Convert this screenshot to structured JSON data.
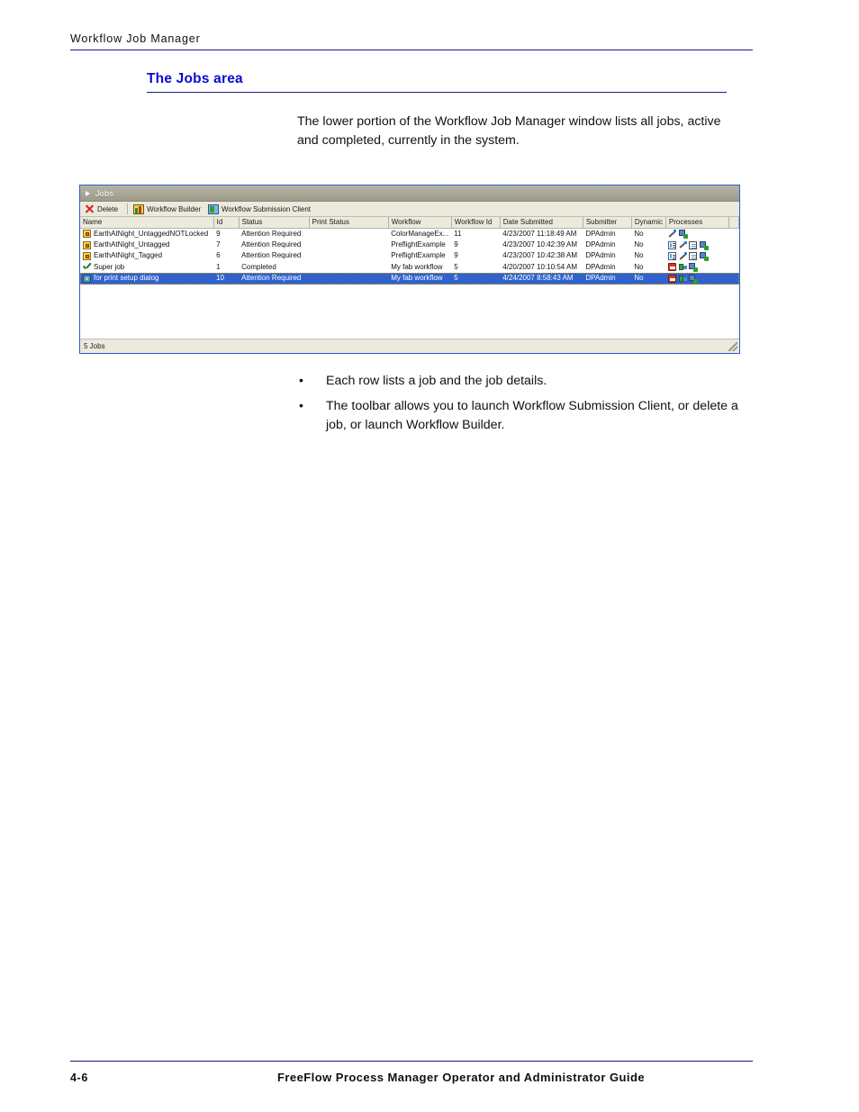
{
  "running_head": {
    "text": "Workflow Job Manager"
  },
  "section": {
    "heading": "The Jobs area"
  },
  "intro": {
    "paragraph": "The lower portion of the Workflow Job Manager window lists all jobs, active and completed, currently in the system."
  },
  "app": {
    "panel_title": "Jobs",
    "expander_icon": "triangle-right-icon",
    "toolbar": {
      "delete_label": "Delete",
      "delete_icon": "red-x-delete-icon",
      "workflow_builder_label": "Workflow Builder",
      "workflow_builder_icon": "workflow-builder-icon",
      "workflow_submission_client_label": "Workflow Submission Client",
      "workflow_submission_client_icon": "workflow-submission-client-icon"
    },
    "columns": [
      "Name",
      "Id",
      "Status",
      "Print Status",
      "Workflow",
      "Workflow Id",
      "Date Submitted",
      "Submitter",
      "Dynamic",
      "Processes"
    ],
    "rows": [
      {
        "icon": "folder-job-icon",
        "name": "EarthAtNight_UntaggedNOTLocked",
        "id": "9",
        "status": "Attention Required",
        "print_status": "",
        "workflow": "ColorManageEx...",
        "workflow_id": "11",
        "date_submitted": "4/23/2007 11:18:49 AM",
        "submitter": "DPAdmin",
        "dynamic": "No",
        "processes": [
          "wand-icon",
          "output-icon"
        ],
        "selected": false
      },
      {
        "icon": "folder-job-icon",
        "name": "EarthAtNight_Untagged",
        "id": "7",
        "status": "Attention Required",
        "print_status": "",
        "workflow": "PreflightExample",
        "workflow_id": "9",
        "date_submitted": "4/23/2007 10:42:39 AM",
        "submitter": "DPAdmin",
        "dynamic": "No",
        "processes": [
          "list-icon",
          "wand-icon",
          "document-icon",
          "output-icon"
        ],
        "selected": false
      },
      {
        "icon": "folder-job-icon",
        "name": "EarthAtNight_Tagged",
        "id": "6",
        "status": "Attention Required",
        "print_status": "",
        "workflow": "PreflightExample",
        "workflow_id": "9",
        "date_submitted": "4/23/2007 10:42:38 AM",
        "submitter": "DPAdmin",
        "dynamic": "No",
        "processes": [
          "list-icon",
          "wand-icon",
          "document-icon",
          "output-icon"
        ],
        "selected": false
      },
      {
        "icon": "check-job-icon",
        "name": "Super job",
        "id": "1",
        "status": "Completed",
        "print_status": "",
        "workflow": "My fab workflow",
        "workflow_id": "5",
        "date_submitted": "4/20/2007 10:10:54 AM",
        "submitter": "DPAdmin",
        "dynamic": "No",
        "processes": [
          "print-icon",
          "split-icon",
          "output-icon"
        ],
        "selected": false
      },
      {
        "icon": "gear-job-icon",
        "name": "for print setup dialog",
        "id": "10",
        "status": "Attention Required",
        "print_status": "",
        "workflow": "My fab workflow",
        "workflow_id": "5",
        "date_submitted": "4/24/2007 8:58:43 AM",
        "submitter": "DPAdmin",
        "dynamic": "No",
        "processes": [
          "print-icon",
          "split-icon",
          "output-icon"
        ],
        "selected": true
      }
    ],
    "statusbar": {
      "text": "5 Jobs",
      "resize_grip_icon": "resize-grip-icon"
    },
    "colors": {
      "selection": "#2f62cd",
      "titlebar": "#a9a695",
      "toolbar": "#ece9dd",
      "window_border": "#2a5fd0"
    }
  },
  "bullets": [
    {
      "marker": "•",
      "text": "Each row lists a job and the job details."
    },
    {
      "marker": "•",
      "text": "The toolbar allows you to launch Workflow Submission Client, or delete a job, or launch Workflow Builder."
    }
  ],
  "footer": {
    "page_number": "4-6",
    "guide_title": "FreeFlow Process Manager Operator and Administrator Guide"
  }
}
